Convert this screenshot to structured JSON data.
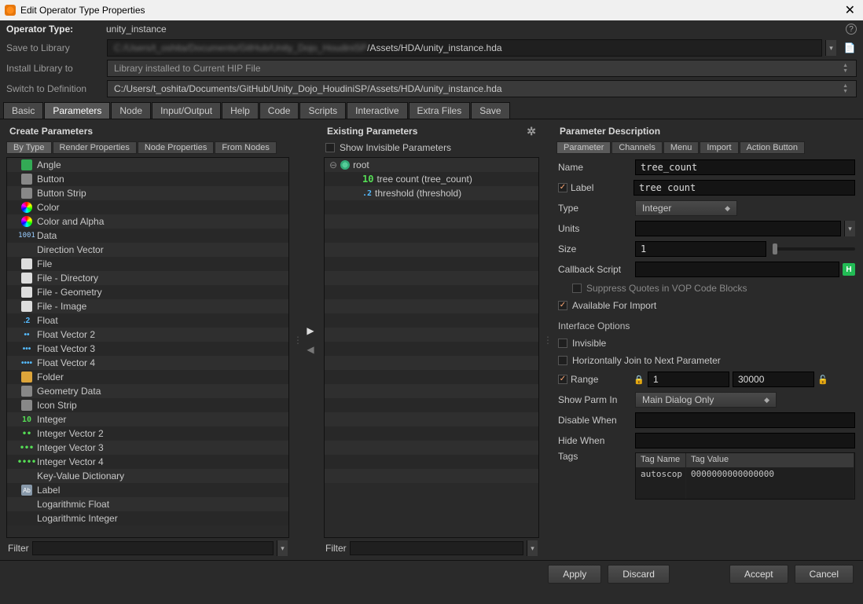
{
  "window": {
    "title": "Edit Operator Type Properties"
  },
  "header": {
    "op_type_label": "Operator Type:",
    "op_type_value": "unity_instance",
    "save_label": "Save to Library",
    "save_path_suffix": "/Assets/HDA/unity_instance.hda",
    "install_label": "Install Library to",
    "install_value": "Library installed to Current HIP File",
    "switch_label": "Switch to Definition",
    "switch_value": "C:/Users/t_oshita/Documents/GitHub/Unity_Dojo_HoudiniSP/Assets/HDA/unity_instance.hda"
  },
  "main_tabs": [
    "Basic",
    "Parameters",
    "Node",
    "Input/Output",
    "Help",
    "Code",
    "Scripts",
    "Interactive",
    "Extra Files",
    "Save"
  ],
  "main_tab_active": "Parameters",
  "create": {
    "header": "Create Parameters",
    "subtabs": [
      "By Type",
      "Render Properties",
      "Node Properties",
      "From Nodes"
    ],
    "sub_active": "By Type",
    "types": [
      "Angle",
      "Button",
      "Button Strip",
      "Color",
      "Color and Alpha",
      "Data",
      "Direction Vector",
      "File",
      "File - Directory",
      "File - Geometry",
      "File - Image",
      "Float",
      "Float Vector 2",
      "Float Vector 3",
      "Float Vector 4",
      "Folder",
      "Geometry Data",
      "Icon Strip",
      "Integer",
      "Integer Vector 2",
      "Integer Vector 3",
      "Integer Vector 4",
      "Key-Value Dictionary",
      "Label",
      "Logarithmic Float",
      "Logarithmic Integer"
    ],
    "filter_label": "Filter"
  },
  "existing": {
    "header": "Existing Parameters",
    "show_invisible": "Show Invisible Parameters",
    "root": "root",
    "params": [
      {
        "badge": "10",
        "label": "tree count (tree_count)"
      },
      {
        "badge": ".2",
        "label": "threshold (threshold)"
      }
    ],
    "filter_label": "Filter"
  },
  "desc": {
    "header": "Parameter Description",
    "tabs": [
      "Parameter",
      "Channels",
      "Menu",
      "Import",
      "Action Button"
    ],
    "tab_active": "Parameter",
    "name_label": "Name",
    "name_value": "tree_count",
    "label_label": "Label",
    "label_value": "tree count",
    "type_label": "Type",
    "type_value": "Integer",
    "units_label": "Units",
    "units_value": "",
    "size_label": "Size",
    "size_value": "1",
    "callback_label": "Callback Script",
    "callback_value": "",
    "suppress": "Suppress Quotes in VOP Code Blocks",
    "avail_import": "Available For Import",
    "interface_section": "Interface Options",
    "invisible": "Invisible",
    "horiz_join": "Horizontally Join to Next Parameter",
    "range_label": "Range",
    "range_min": "1",
    "range_max": "30000",
    "show_parm_label": "Show Parm In",
    "show_parm_value": "Main Dialog Only",
    "disable_label": "Disable When",
    "disable_value": "",
    "hide_label": "Hide When",
    "hide_value": "",
    "tags_label": "Tags",
    "tag_col_name": "Tag Name",
    "tag_col_value": "Tag Value",
    "tag_row_name": "autoscop",
    "tag_row_value": "0000000000000000"
  },
  "footer": {
    "apply": "Apply",
    "discard": "Discard",
    "accept": "Accept",
    "cancel": "Cancel"
  }
}
